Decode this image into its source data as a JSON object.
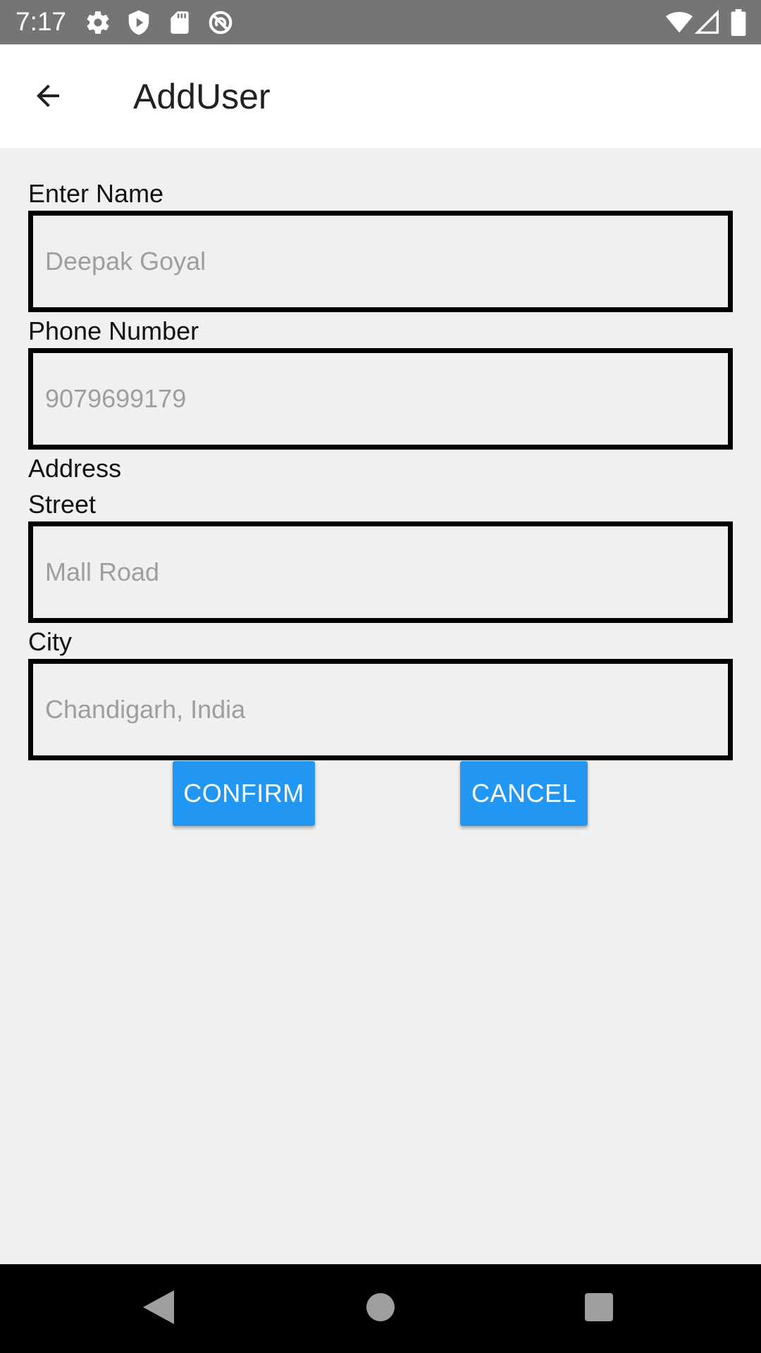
{
  "status_bar": {
    "time": "7:17",
    "icons": [
      "settings-icon",
      "shield-icon",
      "sd-card-icon",
      "no-sync-icon",
      "wifi-icon",
      "signal-icon",
      "battery-icon"
    ]
  },
  "app_bar": {
    "title": "AddUser",
    "back_icon": "arrow-left-icon"
  },
  "form": {
    "name_label": "Enter Name",
    "name_value": "Deepak Goyal",
    "phone_label": "Phone Number",
    "phone_value": "9079699179",
    "address_label": "Address",
    "street_label": "Street",
    "street_value": "Mall Road",
    "city_label": "City",
    "city_value": "Chandigarh, India"
  },
  "actions": {
    "confirm_label": "CONFIRM",
    "cancel_label": "CANCEL"
  },
  "nav_bar": {
    "icons": [
      "back-triangle-icon",
      "home-circle-icon",
      "recents-square-icon"
    ]
  },
  "colors": {
    "status_bar": "#757575",
    "background": "#f0f0f0",
    "accent": "#2196f3",
    "field_border": "#000000",
    "value_text": "#9e9e9e"
  }
}
